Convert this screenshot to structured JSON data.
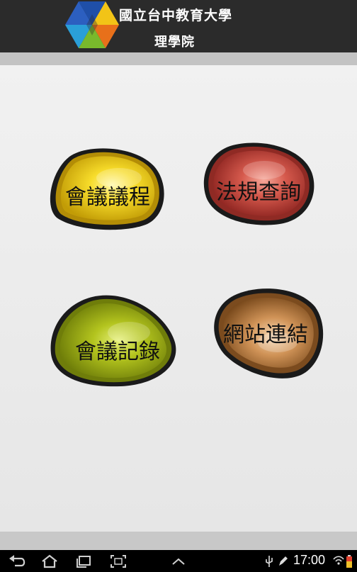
{
  "header": {
    "title_line1": "國立台中教育大學",
    "title_line2": "理學院"
  },
  "buttons": [
    {
      "label": "會議議程",
      "color": "#f4d21a"
    },
    {
      "label": "法規查詢",
      "color": "#c9443c"
    },
    {
      "label": "會議記錄",
      "color": "#a8b81c"
    },
    {
      "label": "網站連結",
      "color": "#c48a4a"
    }
  ],
  "status_bar": {
    "time": "17:00"
  }
}
